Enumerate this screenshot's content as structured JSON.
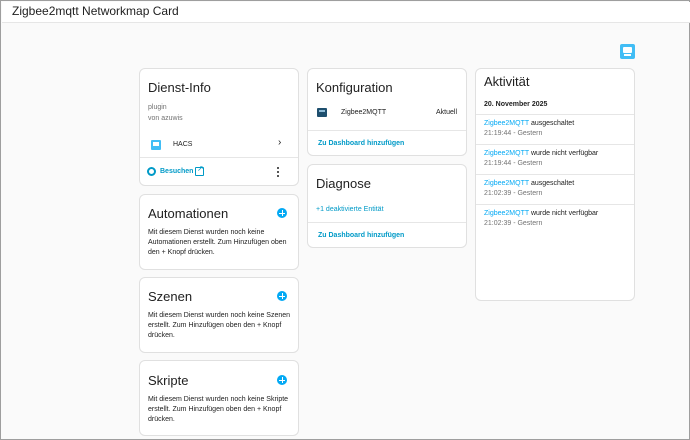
{
  "window": {
    "title": "Zigbee2mqtt Networkmap Card"
  },
  "dienst_info": {
    "title": "Dienst-Info",
    "type": "plugin",
    "author": "von azuwis",
    "provider": "HACS",
    "visit_label": "Besuchen"
  },
  "automationen": {
    "title": "Automationen",
    "text": "Mit diesem Dienst wurden noch keine Automationen erstellt. Zum Hinzufügen oben den + Knopf drücken."
  },
  "szenen": {
    "title": "Szenen",
    "text": "Mit diesem Dienst wurden noch keine Szenen erstellt. Zum Hinzufügen oben den + Knopf drücken."
  },
  "skripte": {
    "title": "Skripte",
    "text": "Mit diesem Dienst wurden noch keine Skripte erstellt. Zum Hinzufügen oben den + Knopf drücken."
  },
  "konfiguration": {
    "title": "Konfiguration",
    "entity_name": "Zigbee2MQTT",
    "entity_state": "Aktuell",
    "add_dashboard": "Zu Dashboard hinzufügen"
  },
  "diagnose": {
    "title": "Diagnose",
    "disabled_entities": "+1 deaktivierte Entität",
    "add_dashboard": "Zu Dashboard hinzufügen"
  },
  "aktivitaet": {
    "title": "Aktivität",
    "date": "20. November 2025",
    "entries": [
      {
        "entity": "Zigbee2MQTT",
        "action": " ausgeschaltet",
        "time": "21:19:44 - Gestern"
      },
      {
        "entity": "Zigbee2MQTT",
        "action": " wurde nicht verfügbar",
        "time": "21:19:44 - Gestern"
      },
      {
        "entity": "Zigbee2MQTT",
        "action": " ausgeschaltet",
        "time": "21:02:39 - Gestern"
      },
      {
        "entity": "Zigbee2MQTT",
        "action": " wurde nicht verfügbar",
        "time": "21:02:39 - Gestern"
      }
    ]
  },
  "colors": {
    "accent": "#009ac7",
    "link": "#03a9f4",
    "hacs": "#41bdf5"
  }
}
